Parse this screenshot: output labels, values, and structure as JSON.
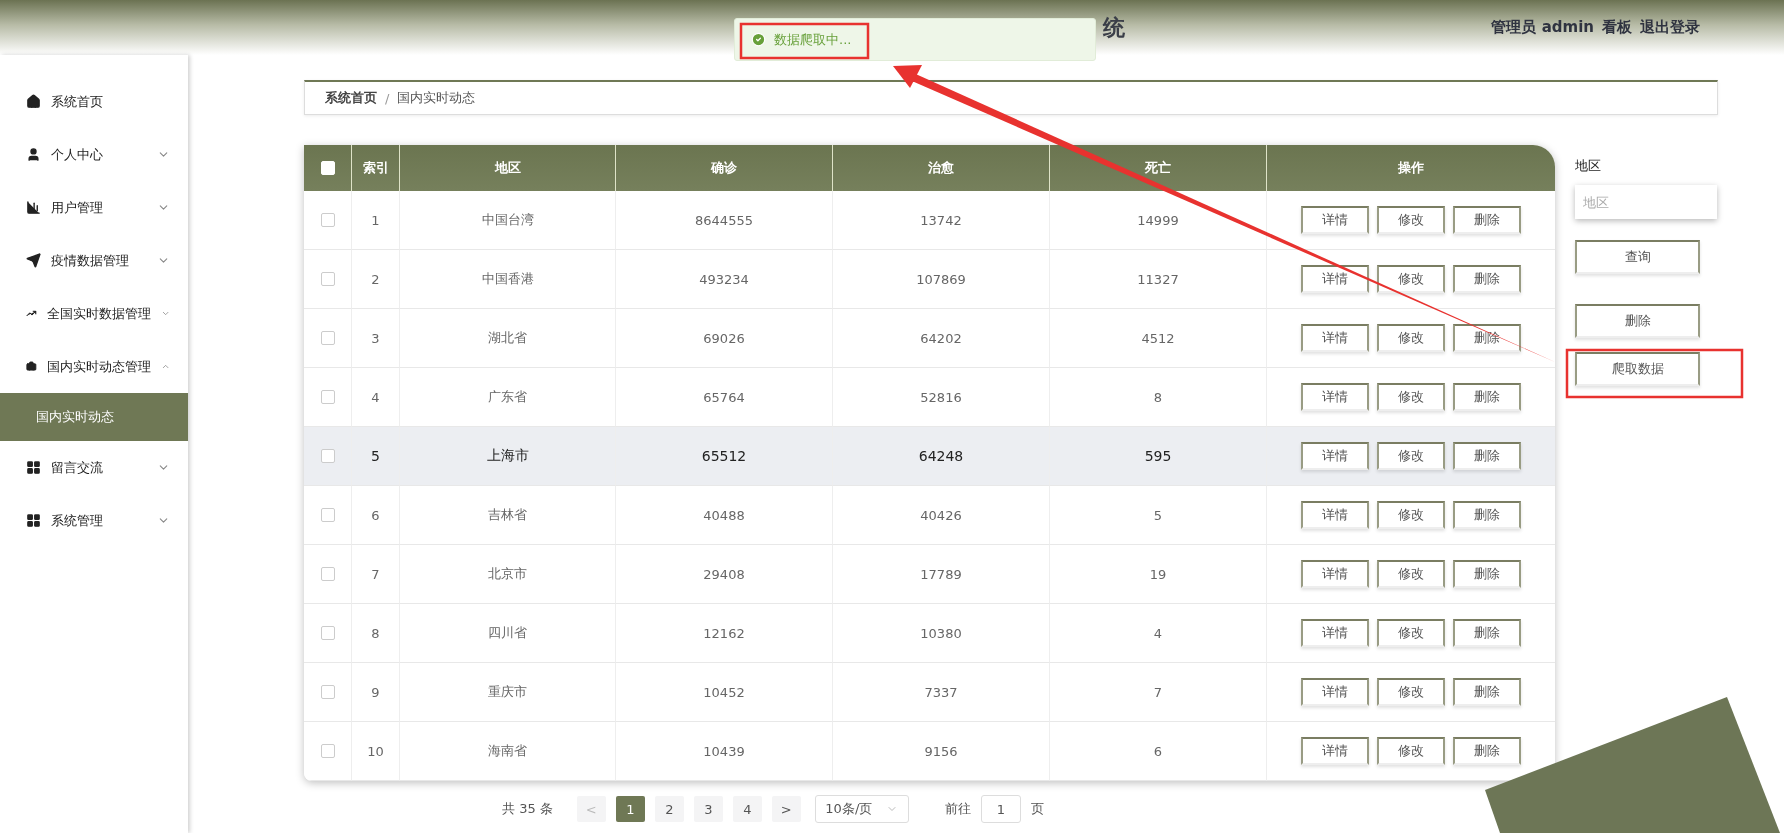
{
  "header": {
    "title_fragment": "统",
    "user": "管理员 admin",
    "links": [
      "看板",
      "退出登录"
    ]
  },
  "toast": {
    "message": "数据爬取中..."
  },
  "sidebar": {
    "items": [
      {
        "label": "系统首页",
        "kind": "link"
      },
      {
        "label": "个人中心",
        "kind": "group",
        "expanded": false
      },
      {
        "label": "用户管理",
        "kind": "group",
        "expanded": false
      },
      {
        "label": "疫情数据管理",
        "kind": "group",
        "expanded": false
      },
      {
        "label": "全国实时数据管理",
        "kind": "group",
        "expanded": false
      },
      {
        "label": "国内实时动态管理",
        "kind": "group",
        "expanded": true,
        "children": [
          {
            "label": "国内实时动态",
            "selected": true
          }
        ]
      },
      {
        "label": "留言交流",
        "kind": "group",
        "expanded": false
      },
      {
        "label": "系统管理",
        "kind": "group",
        "expanded": false
      }
    ]
  },
  "breadcrumb": {
    "items": [
      "系统首页",
      "国内实时动态"
    ],
    "separator": "/"
  },
  "table": {
    "all_checked": false,
    "columns": [
      "索引",
      "地区",
      "确诊",
      "治愈",
      "死亡",
      "操作"
    ],
    "rows": [
      {
        "cells": [
          "1",
          "中国台湾",
          "8644555",
          "13742",
          "14999"
        ],
        "actions": [
          "详情",
          "修改",
          "删除"
        ],
        "checked": false,
        "highlighted": false
      },
      {
        "cells": [
          "2",
          "中国香港",
          "493234",
          "107869",
          "11327"
        ],
        "actions": [
          "详情",
          "修改",
          "删除"
        ],
        "checked": false,
        "highlighted": false
      },
      {
        "cells": [
          "3",
          "湖北省",
          "69026",
          "64202",
          "4512"
        ],
        "actions": [
          "详情",
          "修改",
          "删除"
        ],
        "checked": false,
        "highlighted": false
      },
      {
        "cells": [
          "4",
          "广东省",
          "65764",
          "52816",
          "8"
        ],
        "actions": [
          "详情",
          "修改",
          "删除"
        ],
        "checked": false,
        "highlighted": false
      },
      {
        "cells": [
          "5",
          "上海市",
          "65512",
          "64248",
          "595"
        ],
        "actions": [
          "详情",
          "修改",
          "删除"
        ],
        "checked": false,
        "highlighted": true
      },
      {
        "cells": [
          "6",
          "吉林省",
          "40488",
          "40426",
          "5"
        ],
        "actions": [
          "详情",
          "修改",
          "删除"
        ],
        "checked": false,
        "highlighted": false
      },
      {
        "cells": [
          "7",
          "北京市",
          "29408",
          "17789",
          "19"
        ],
        "actions": [
          "详情",
          "修改",
          "删除"
        ],
        "checked": false,
        "highlighted": false
      },
      {
        "cells": [
          "8",
          "四川省",
          "12162",
          "10380",
          "4"
        ],
        "actions": [
          "详情",
          "修改",
          "删除"
        ],
        "checked": false,
        "highlighted": false
      },
      {
        "cells": [
          "9",
          "重庆市",
          "10452",
          "7337",
          "7"
        ],
        "actions": [
          "详情",
          "修改",
          "删除"
        ],
        "checked": false,
        "highlighted": false
      },
      {
        "cells": [
          "10",
          "海南省",
          "10439",
          "9156",
          "6"
        ],
        "actions": [
          "详情",
          "修改",
          "删除"
        ],
        "checked": false,
        "highlighted": false
      }
    ]
  },
  "search_panel": {
    "label": "地区",
    "placeholder": "地区",
    "buttons": [
      "查询",
      "删除",
      "爬取数据"
    ]
  },
  "pagination": {
    "total": "共 35 条",
    "prev": "<",
    "next": ">",
    "pages": [
      {
        "label": "1",
        "selected": true
      },
      {
        "label": "2",
        "selected": false
      },
      {
        "label": "3",
        "selected": false
      },
      {
        "label": "4",
        "selected": false
      }
    ],
    "page_size": "10条/页",
    "goto_label": "前往",
    "goto_value": "1",
    "goto_suffix": "页"
  }
}
